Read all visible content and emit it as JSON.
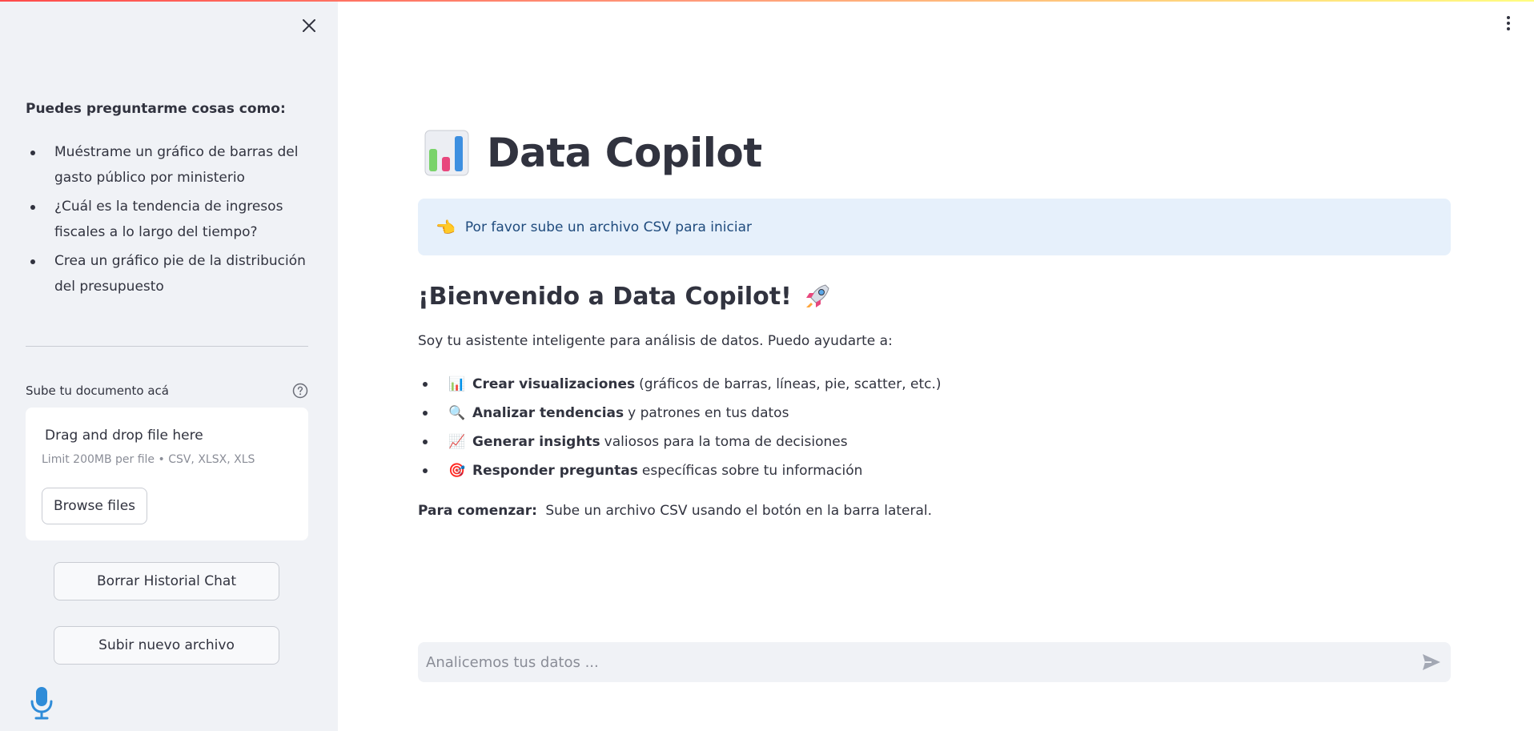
{
  "sidebar": {
    "heading": "Puedes preguntarme cosas como:",
    "examples": [
      "Muéstrame un gráfico de barras del gasto público por ministerio",
      "¿Cuál es la tendencia de ingresos fiscales a lo largo del tiempo?",
      "Crea un gráfico pie de la distribución del presupuesto"
    ],
    "upload_label": "Sube tu documento acá",
    "dropzone_title": "Drag and drop file here",
    "dropzone_limit": "Limit 200MB per file • CSV, XLSX, XLS",
    "browse_label": "Browse files",
    "clear_chat_label": "Borrar Historial Chat",
    "new_file_label": "Subir nuevo archivo"
  },
  "main": {
    "title": "Data Copilot",
    "info_icon": "👈",
    "info_text": "Por favor sube un archivo CSV para iniciar",
    "welcome": "¡Bienvenido a Data Copilot!",
    "intro": "Soy tu asistente inteligente para análisis de datos. Puedo ayudarte a:",
    "features": [
      {
        "icon": "📊",
        "bold": "Crear visualizaciones",
        "text": "(gráficos de barras, líneas, pie, scatter, etc.)"
      },
      {
        "icon": "🔍",
        "bold": "Analizar tendencias",
        "text": "y patrones en tus datos"
      },
      {
        "icon": "📈",
        "bold": "Generar insights",
        "text": "valiosos para la toma de decisiones"
      },
      {
        "icon": "🎯",
        "bold": "Responder preguntas",
        "text": "específicas sobre tu información"
      }
    ],
    "start_bold": "Para comenzar:",
    "start_text": "Sube un archivo CSV usando el botón en la barra lateral."
  },
  "chat": {
    "placeholder": "Analicemos tus datos ..."
  },
  "colors": {
    "sidebar_bg": "#f0f2f6",
    "info_bg": "#e6f0fb",
    "info_text": "#1f4b7d",
    "text": "#31333f",
    "mic": "#2f8cd8"
  },
  "icons": [
    "close-icon",
    "help-icon",
    "mic-icon",
    "kebab-menu-icon",
    "bar-chart-icon",
    "rocket-icon",
    "send-icon"
  ]
}
